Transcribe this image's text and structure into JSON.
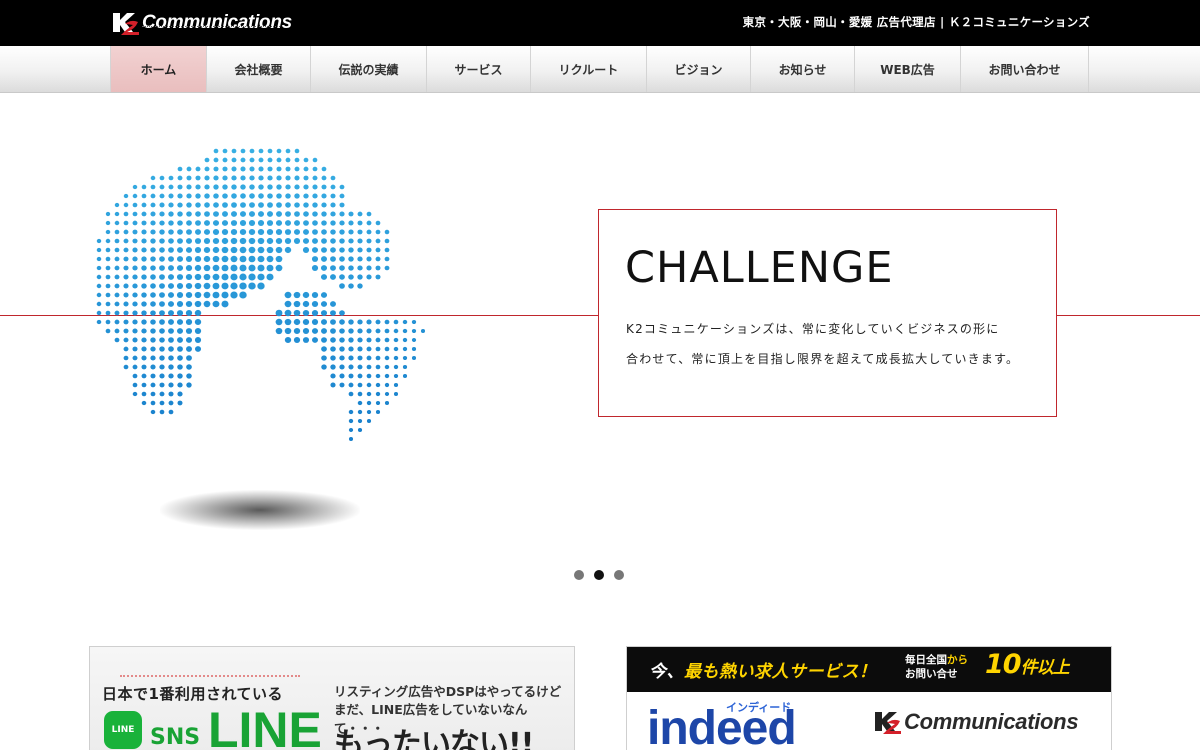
{
  "header": {
    "logo_text": "Communications",
    "tagline": "東京・大阪・岡山・愛媛 広告代理店 | Ｋ２コミュニケーションズ"
  },
  "nav": {
    "items": [
      {
        "label": "ホーム",
        "active": true
      },
      {
        "label": "会社概要"
      },
      {
        "label": "伝説の実績"
      },
      {
        "label": "サービス"
      },
      {
        "label": "リクルート"
      },
      {
        "label": "ビジョン"
      },
      {
        "label": "お知らせ"
      },
      {
        "label": "WEB広告"
      },
      {
        "label": "お問い合わせ"
      }
    ]
  },
  "hero": {
    "title": "CHALLENGE",
    "line1": "K2コミュニケーションズは、常に変化していくビジネスの形に",
    "line2": "合わせて、常に頂上を目指し限界を超えて成長拡大していきます。",
    "slides_total": 3,
    "active_slide": 2
  },
  "banner_left": {
    "lead": "日本で1番利用されている",
    "right_line1": "リスティング広告やDSPはやってるけど",
    "right_line2": "まだ、LINE広告をしていないなんて・・・",
    "badge": "LINE",
    "sns": "SNS",
    "line": "LINE",
    "waste": "もったいない!!"
  },
  "banner_right": {
    "strip_prefix": "今、",
    "strip_emphasis": "最も熱い求人サービス！",
    "daily_line1_a": "毎日全国",
    "daily_line1_b": "から",
    "daily_line2": "お問い合せ",
    "count": "10",
    "count_suffix": "件以上",
    "indeed_kana": "インディード",
    "indeed_logo": "indeed",
    "k2_logo_text": "Communications"
  },
  "colors": {
    "accent_red": "#c0272d",
    "globe_blue": "#1f8fd0",
    "line_green": "#19a335"
  }
}
